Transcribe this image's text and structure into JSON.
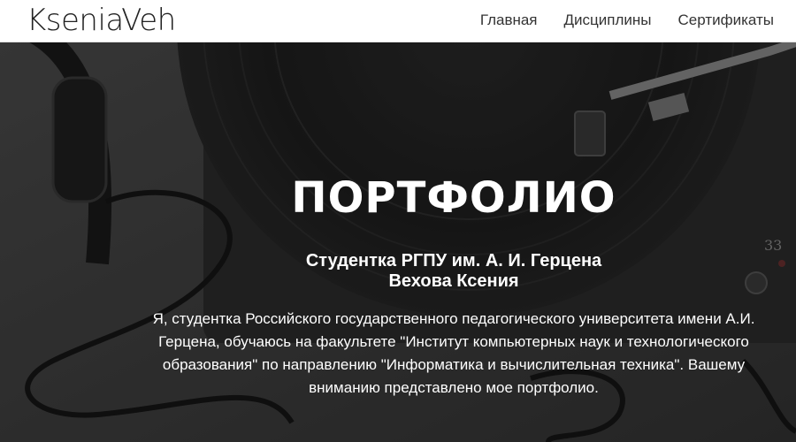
{
  "header": {
    "logo": "KseniaVeh",
    "nav": [
      {
        "label": "Главная"
      },
      {
        "label": "Дисциплины"
      },
      {
        "label": "Сертификаты"
      }
    ]
  },
  "hero": {
    "title": "ПОРТФОЛИО",
    "subtitle_line1": "Студентка РГПУ им. А. И. Герцена",
    "subtitle_line2": "Вехова Ксения",
    "description": "Я, студентка Российского государственного педагогического университета имени А.И. Герцена, обучаюсь на факультете \"Институт компьютерных наук и технологического образования\" по направлению \"Информатика и вычислительная техника\". Вашему вниманию представлено мое портфолио.",
    "background_label": "33",
    "background_theme": "turntable-and-headphones-photo"
  }
}
